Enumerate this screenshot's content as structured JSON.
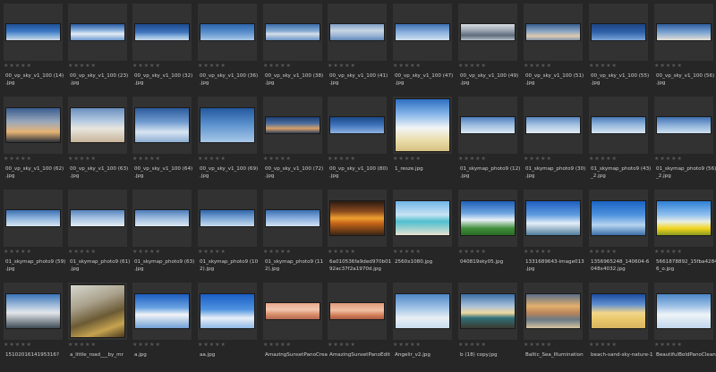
{
  "browser": {
    "rating": "★★★★★",
    "items": [
      {
        "name": "00_vp_sky_v1_100 (14)\n.jpg",
        "kind": "pano",
        "g": "linear-gradient(180deg,#1e4f96 0%,#3f79c4 45%,#7aaad9 70%,#cfd9e3 100%)"
      },
      {
        "name": "00_vp_sky_v1_100 (23)\n.jpg",
        "kind": "pano",
        "g": "linear-gradient(180deg,#2a5aa3 0%,#8fb5de 40%,#e3ecf4 60%,#6f9ad0 100%)"
      },
      {
        "name": "00_vp_sky_v1_100 (32)\n.jpg",
        "kind": "pano",
        "g": "linear-gradient(180deg,#1b4a8e 0%,#3f74bd 50%,#97bde2 80%,#c8d8e6 100%)"
      },
      {
        "name": "00_vp_sky_v1_100 (36)\n.jpg",
        "kind": "pano",
        "g": "linear-gradient(180deg,#2a64ad 0%,#5a8fcc 50%,#a8c7e6 100%)"
      },
      {
        "name": "00_vp_sky_v1_100 (38)\n.jpg",
        "kind": "pano",
        "g": "linear-gradient(180deg,#3c6da9 0%,#8bafd6 45%,#d5dfe8 60%,#6a94c7 100%)"
      },
      {
        "name": "00_vp_sky_v1_100 (41)\n.jpg",
        "kind": "pano",
        "g": "linear-gradient(180deg,#7f9fc6 0%,#c8d5e2 40%,#9cb6d4 70%,#5f86b7 100%)"
      },
      {
        "name": "00_vp_sky_v1_100 (47)\n.jpg",
        "kind": "pano",
        "g": "linear-gradient(180deg,#3d70b3 0%,#8ab0dc 50%,#cfe0ef 100%)"
      },
      {
        "name": "00_vp_sky_v1_100 (49)\n.jpg",
        "kind": "pano",
        "g": "linear-gradient(180deg,#d9dde2 0%,#9aa4b0 40%,#5e6b7b 70%,#b5c0cc 100%)"
      },
      {
        "name": "00_vp_sky_v1_100 (51)\n.jpg",
        "kind": "pano",
        "g": "linear-gradient(180deg,#375d8f 0%,#8da6c4 45%,#e0cbb1 75%,#7f93ab 100%)"
      },
      {
        "name": "00_vp_sky_v1_100 (55)\n.jpg",
        "kind": "pano",
        "g": "linear-gradient(180deg,#1c4582 0%,#2f62ab 50%,#7ba5d6 100%)"
      },
      {
        "name": "00_vp_sky_v1_100 (56)\n.jpg",
        "kind": "pano",
        "g": "linear-gradient(180deg,#2f5e9f 0%,#7aa3d1 50%,#e6e0d6 100%)"
      },
      {
        "name": "00_vp_sky_v1_100 (62)\n.jpg",
        "kind": "wide",
        "g": "linear-gradient(180deg,#3a5d8f 0%,#9aa8bb 40%,#e6b374 70%,#2a2f38 100%)"
      },
      {
        "name": "00_vp_sky_v1_100 (63)\n.jpg",
        "kind": "wide",
        "g": "linear-gradient(180deg,#6a8fbf 0%,#b9cde2 40%,#e8e6dd 60%,#c7b39a 100%)"
      },
      {
        "name": "00_vp_sky_v1_100 (64)\n.jpg",
        "kind": "wide",
        "g": "linear-gradient(180deg,#2c5b9c 0%,#6f9ad0 40%,#d8e5f1 70%,#8daed3 100%)"
      },
      {
        "name": "00_vp_sky_v1_100 (69)\n.jpg",
        "kind": "wide",
        "g": "linear-gradient(180deg,#23589e 0%,#5e94cf 50%,#a8c8e8 100%)"
      },
      {
        "name": "00_vp_sky_v1_100 (72)\n.jpg",
        "kind": "pano",
        "g": "linear-gradient(180deg,#1e3f73 0%,#4c6f9f 40%,#d9a16b 70%,#2f3f58 100%)"
      },
      {
        "name": "00_vp_sky_v1_100 (80)\n.jpg",
        "kind": "pano",
        "g": "linear-gradient(180deg,#1b4888 0%,#3f74bd 50%,#8fb3de 100%)"
      },
      {
        "name": "1_resze.jpg",
        "kind": "square",
        "g": "linear-gradient(180deg,#2d6fc2 0%,#8ab8ea 30%,#f2f5f7 55%,#e9dca8 80%,#d6c082 100%)"
      },
      {
        "name": "01_skymap_photo9 (12)\n.jpg",
        "kind": "pano",
        "g": "linear-gradient(180deg,#4f7fbf 0%,#9cbde0 50%,#dce8f2 100%)"
      },
      {
        "name": "01_skymap_photo9 (30)\n.jpg",
        "kind": "pano",
        "g": "linear-gradient(180deg,#5a88c2 0%,#a9c5e3 50%,#e2ebf3 100%)"
      },
      {
        "name": "01_skymap_photo9 (43)\n_2.jpg",
        "kind": "pano",
        "g": "linear-gradient(180deg,#4a7bb9 0%,#97b9dd 50%,#d7e4f0 100%)"
      },
      {
        "name": "01_skymap_photo9 (56)\n_2.jpg",
        "kind": "pano",
        "g": "linear-gradient(180deg,#3f71b1 0%,#8cb0d9 50%,#cfe0ef 100%)"
      },
      {
        "name": "01_skymap_photo9 (59)\n.jpg",
        "kind": "pano",
        "g": "linear-gradient(180deg,#3b6eb0 0%,#8eb3dc 50%,#d7e5f1 100%)"
      },
      {
        "name": "01_skymap_photo9 (61)\n.jpg",
        "kind": "pano",
        "g": "linear-gradient(180deg,#5582bd 0%,#a6c3e2 50%,#e5edf4 100%)"
      },
      {
        "name": "01_skymap_photo9 (63)\n.jpg",
        "kind": "pano",
        "g": "linear-gradient(180deg,#4c7bb8 0%,#9dbcdf 50%,#dde8f2 100%)"
      },
      {
        "name": "01_skymap_photo9 (10\n2).jpg",
        "kind": "pano",
        "g": "linear-gradient(180deg,#2f64aa 0%,#7ba6d6 50%,#cadcee 100%)"
      },
      {
        "name": "01_skymap_photo9 (11\n2).jpg",
        "kind": "pano",
        "g": "linear-gradient(180deg,#3a6db0 0%,#88aede 50%,#d2e2f1 100%)"
      },
      {
        "name": "6a010536fa9ded970b01\n92ac37f2a1970d.jpg",
        "kind": "wide",
        "g": "linear-gradient(180deg,#2b1a12 0%,#8a4a1e 30%,#f0a030 50%,#c46418 65%,#3a2415 100%)"
      },
      {
        "name": "2560x1080.jpg",
        "kind": "wide",
        "g": "linear-gradient(180deg,#6fb6e8 0%,#c9e4f4 40%,#4fbfcf 60%,#e8e2d0 100%)"
      },
      {
        "name": "040819sky05.jpg",
        "kind": "wide",
        "g": "linear-gradient(180deg,#1f5fb8 0%,#6ea4e0 35%,#e9f0f7 55%,#3f8f3a 80%,#2a6a25 100%)"
      },
      {
        "name": "1331689643-image013\n.jpg",
        "kind": "wide",
        "g": "linear-gradient(180deg,#1e5fc0 0%,#5f9be0 40%,#e4eef7 65%,#4f7c9a 100%)"
      },
      {
        "name": "1356965248_140604-6\n048x4032.jpg",
        "kind": "wide",
        "g": "linear-gradient(180deg,#1a64c4 0%,#4e92de 40%,#b6d4ef 70%,#3a6fa8 100%)"
      },
      {
        "name": "5661878892_15fba4284\n6_o.jpg",
        "kind": "wide",
        "g": "linear-gradient(180deg,#2e7fd6 0%,#8fc0ee 40%,#e7efe4 60%,#f2d51e 80%,#8a9a20 100%)"
      },
      {
        "name": "1510201614195316?",
        "kind": "wide",
        "g": "linear-gradient(180deg,#3a73b8 0%,#b7cbe0 40%,#e3e6ea 55%,#3d4a55 100%)"
      },
      {
        "name": "a_little_road___by_mr",
        "kind": "square",
        "g": "linear-gradient(160deg,#d7d8d0 0%,#a9a08a 35%,#6b5a34 60%,#c6a350 80%,#4a3a20 100%)"
      },
      {
        "name": "a.jpg",
        "kind": "wide",
        "g": "linear-gradient(180deg,#1c5dc0 0%,#6aa3e2 40%,#f1f4f7 60%,#6fa0d4 100%)"
      },
      {
        "name": "aa.jpg",
        "kind": "wide",
        "g": "linear-gradient(180deg,#1a5ec6 0%,#4f93e0 45%,#e8f0f8 70%,#8fb9e6 100%)"
      },
      {
        "name": "AmazingSunsetPanoCrea",
        "kind": "pano",
        "g": "linear-gradient(180deg,#e7a98c 0%,#f2c7b0 40%,#d98e6c 70%,#b26a52 100%)"
      },
      {
        "name": "AmazingSunsetPanoEdit",
        "kind": "pano",
        "g": "linear-gradient(180deg,#e09a7a 0%,#f0c0a4 45%,#d27e58 75%,#a75c44 100%)"
      },
      {
        "name": "Angelir_v2.jpg",
        "kind": "wide",
        "g": "linear-gradient(180deg,#4f87c6 0%,#9fc3e6 40%,#e8eff5 70%,#c9dced 100%)"
      },
      {
        "name": "b (18) copy.jpg",
        "kind": "wide",
        "g": "linear-gradient(180deg,#3b6ea8 0%,#a9c1d8 35%,#f0d8a0 55%,#2f6f78 70%,#3a3a30 100%)"
      },
      {
        "name": "Baltic_Sea_Illumination",
        "kind": "wide",
        "g": "linear-gradient(180deg,#5a6e8a 0%,#e3b06c 35%,#b9855a 55%,#6a7a84 75%,#d6c4a0 100%)"
      },
      {
        "name": "beach-sand-sky-nature-1",
        "kind": "wide",
        "g": "linear-gradient(180deg,#1b4c9e 0%,#5f8fd0 30%,#f2d68a 55%,#e9c76a 75%,#d8b460 100%)"
      },
      {
        "name": "BeautifulBoldPanoClean",
        "kind": "wide",
        "g": "linear-gradient(180deg,#4c86c8 0%,#9ec1e6 35%,#eef3f7 60%,#c0d6ec 100%)"
      }
    ]
  }
}
